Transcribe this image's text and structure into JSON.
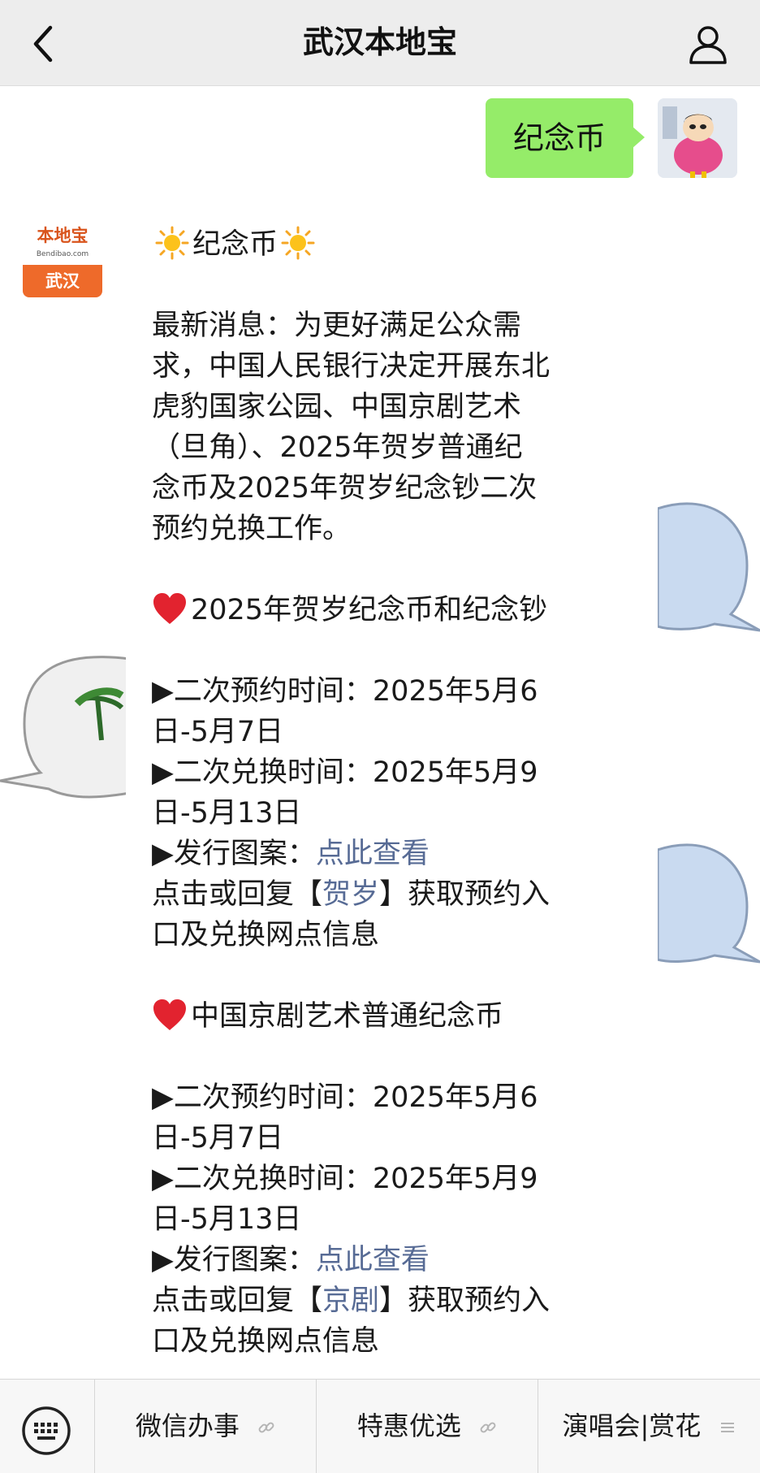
{
  "header": {
    "title": "武汉本地宝"
  },
  "user_message": {
    "text": "纪念币"
  },
  "account": {
    "logo_text": "本地宝",
    "logo_sub": "Bendibao.com",
    "city": "武汉"
  },
  "reply": {
    "title": "纪念币",
    "intro": [
      "最新消息：为更好满足公众需",
      "求，中国人民银行决定开展东北",
      "虎豹国家公园、中国京剧艺术",
      "（旦角）、2025年贺岁普通纪",
      "念币及2025年贺岁纪念钞二次",
      "预约兑换工作。"
    ],
    "section1": {
      "heading": "2025年贺岁纪念币和纪念钞",
      "appt_lines": [
        "▶二次预约时间：2025年5月6",
        "日-5月7日"
      ],
      "exch_lines": [
        "▶二次兑换时间：2025年5月9",
        "日-5月13日"
      ],
      "design_label": "▶发行图案：",
      "design_link": "点此查看",
      "reply_pre": "点击或回复【",
      "reply_key": "贺岁",
      "reply_post": "】获取预约入",
      "reply_line2": "口及兑换网点信息"
    },
    "section2": {
      "heading": "中国京剧艺术普通纪念币",
      "appt_lines": [
        "▶二次预约时间：2025年5月6",
        "日-5月7日"
      ],
      "exch_lines": [
        "▶二次兑换时间：2025年5月9",
        "日-5月13日"
      ],
      "design_label": "▶发行图案：",
      "design_link": "点此查看",
      "reply_pre": "点击或回复【",
      "reply_key": "京剧",
      "reply_post": "】获取预约入",
      "reply_line2": "口及兑换网点信息"
    }
  },
  "bottom_menu": {
    "items": [
      {
        "label": "微信办事",
        "icon": "link-icon"
      },
      {
        "label": "特惠优选",
        "icon": "link-icon"
      },
      {
        "label": "演唱会|赏花",
        "icon": "menu-icon"
      }
    ]
  },
  "colors": {
    "bubble_green": "#95ec69",
    "link": "#576b95",
    "accent_orange": "#ee6a2a"
  }
}
